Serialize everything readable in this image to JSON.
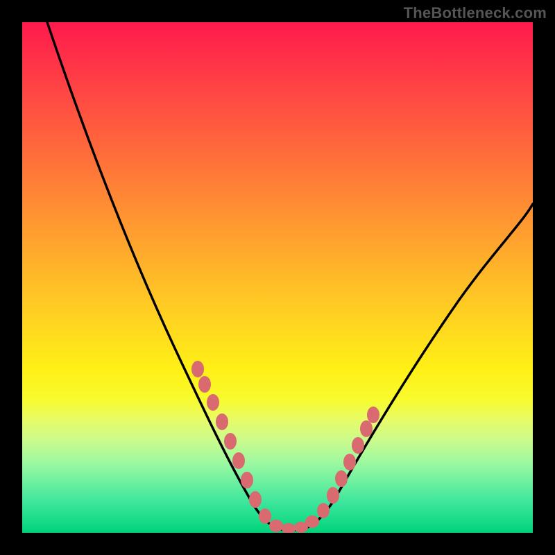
{
  "watermark": "TheBottleneck.com",
  "chart_data": {
    "type": "line",
    "title": "",
    "xlabel": "",
    "ylabel": "",
    "xlim": [
      0,
      100
    ],
    "ylim": [
      0,
      100
    ],
    "series": [
      {
        "name": "bottleneck-curve",
        "x": [
          5,
          10,
          15,
          20,
          25,
          30,
          35,
          38,
          41,
          44,
          46,
          48,
          50,
          52,
          54,
          56,
          58,
          61,
          65,
          70,
          75,
          80,
          85,
          90,
          95,
          100
        ],
        "y": [
          100,
          88,
          77,
          66,
          55,
          45,
          35,
          28,
          21,
          14,
          9,
          5,
          2,
          1,
          1,
          3,
          7,
          13,
          21,
          31,
          40,
          47,
          53,
          58,
          62,
          65
        ]
      }
    ],
    "markers": {
      "name": "highlight-dots",
      "x": [
        35,
        36.5,
        38,
        40,
        41.5,
        43,
        44.5,
        46,
        48,
        50,
        52,
        54,
        56,
        57.5,
        59,
        60.5,
        62,
        63.5
      ],
      "y": [
        35,
        31,
        27,
        22,
        18,
        14,
        10,
        7,
        3,
        1,
        1,
        3,
        6,
        9,
        13,
        17,
        21,
        25
      ]
    },
    "gradient_bands": [
      {
        "color": "red",
        "range": [
          55,
          100
        ]
      },
      {
        "color": "orange",
        "range": [
          30,
          55
        ]
      },
      {
        "color": "yellow",
        "range": [
          8,
          30
        ]
      },
      {
        "color": "green",
        "range": [
          0,
          8
        ]
      }
    ]
  }
}
